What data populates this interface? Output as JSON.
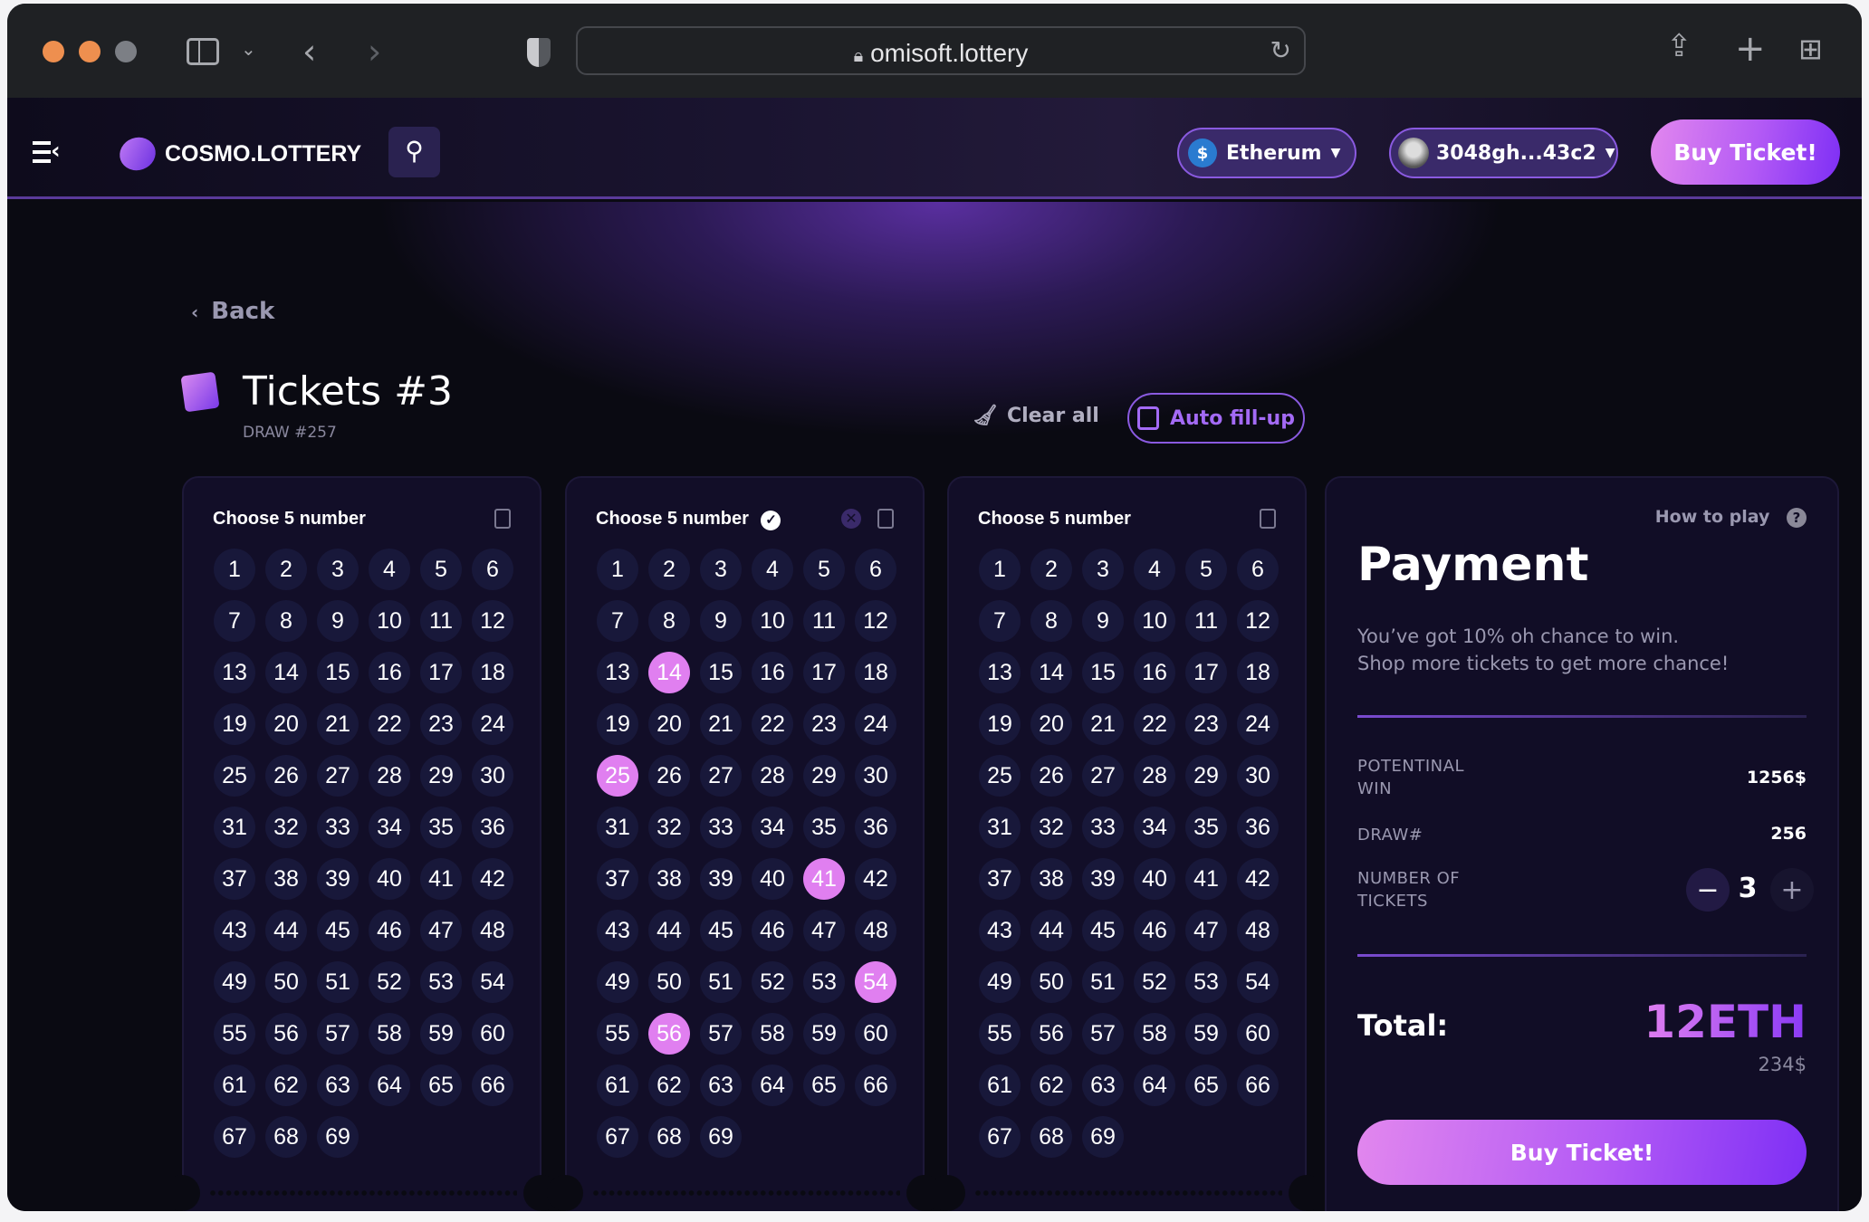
{
  "browser": {
    "url": "omisoft.lottery"
  },
  "nav": {
    "brand": "COSMO.LOTTERY",
    "network": "Etherum",
    "wallet": "3048gh...43c2",
    "buy_label": "Buy Ticket!"
  },
  "page": {
    "back_label": "Back",
    "title": "Tickets #3",
    "draw": "DRAW #257",
    "clear_label": "Clear all",
    "autofill_label": "Auto fill-up"
  },
  "tickets": {
    "number_range": [
      1,
      69
    ],
    "selected_color": "#e07ff0",
    "items": [
      {
        "title": "Choose 5 number",
        "complete": false,
        "selected": []
      },
      {
        "title": "Choose 5 number",
        "complete": true,
        "selected": [
          14,
          25,
          41,
          54,
          56
        ]
      },
      {
        "title": "Choose 5 number",
        "complete": false,
        "selected": []
      }
    ]
  },
  "payment": {
    "how_to_play": "How to play",
    "title": "Payment",
    "desc_line1": "You’ve got 10% oh chance to win.",
    "desc_line2": "Shop more tickets to get more chance!",
    "potential_label_1": "POTENTINAL",
    "potential_label_2": "WIN",
    "potential_value": "1256$",
    "draw_label": "DRAW#",
    "draw_value": "256",
    "tickets_label_1": "NUMBER OF",
    "tickets_label_2": "TICKETS",
    "tickets_count": "3",
    "minus": "−",
    "plus": "+",
    "total_label": "Total:",
    "total_value": "12ETH",
    "total_usd": "234$",
    "buy_label": "Buy Ticket!"
  }
}
